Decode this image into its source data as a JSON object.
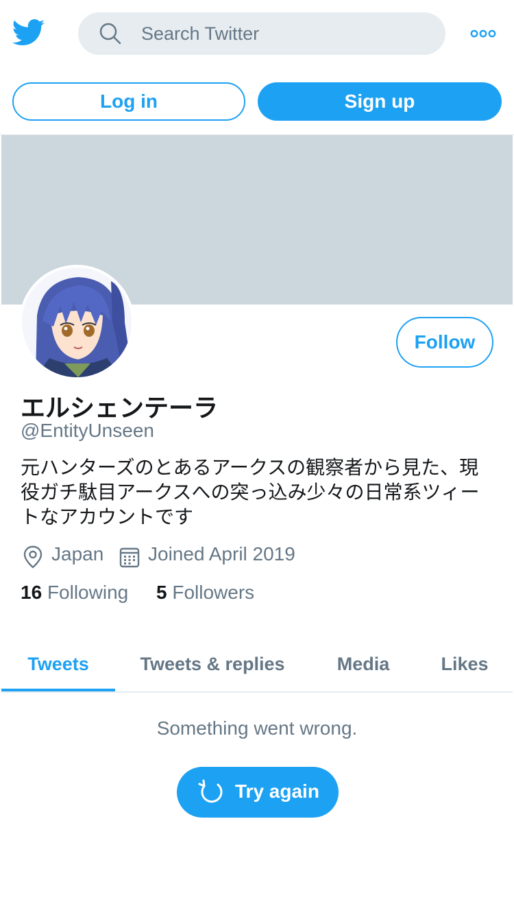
{
  "header": {
    "search_placeholder": "Search Twitter",
    "more_icon": "more-dots-icon",
    "logo_icon": "twitter-bird-icon"
  },
  "auth": {
    "login_label": "Log in",
    "signup_label": "Sign up"
  },
  "profile": {
    "display_name": "エルシェンテーラ",
    "handle": "@EntityUnseen",
    "bio": "元ハンターズのとあるアークスの観察者から見た、現役ガチ駄目アークスへの突っ込み少々の日常系ツィートなアカウントです",
    "location": "Japan",
    "joined": "Joined April 2019",
    "following_count": "16",
    "following_label": "Following",
    "followers_count": "5",
    "followers_label": "Followers",
    "follow_label": "Follow"
  },
  "tabs": [
    {
      "label": "Tweets",
      "active": true
    },
    {
      "label": "Tweets & replies",
      "active": false
    },
    {
      "label": "Media",
      "active": false
    },
    {
      "label": "Likes",
      "active": false
    }
  ],
  "timeline": {
    "error_message": "Something went wrong.",
    "retry_label": "Try again"
  },
  "colors": {
    "brand": "#1da1f2",
    "banner": "#ccd6dd",
    "muted_text": "#657786",
    "search_bg": "#e6ecf0"
  }
}
